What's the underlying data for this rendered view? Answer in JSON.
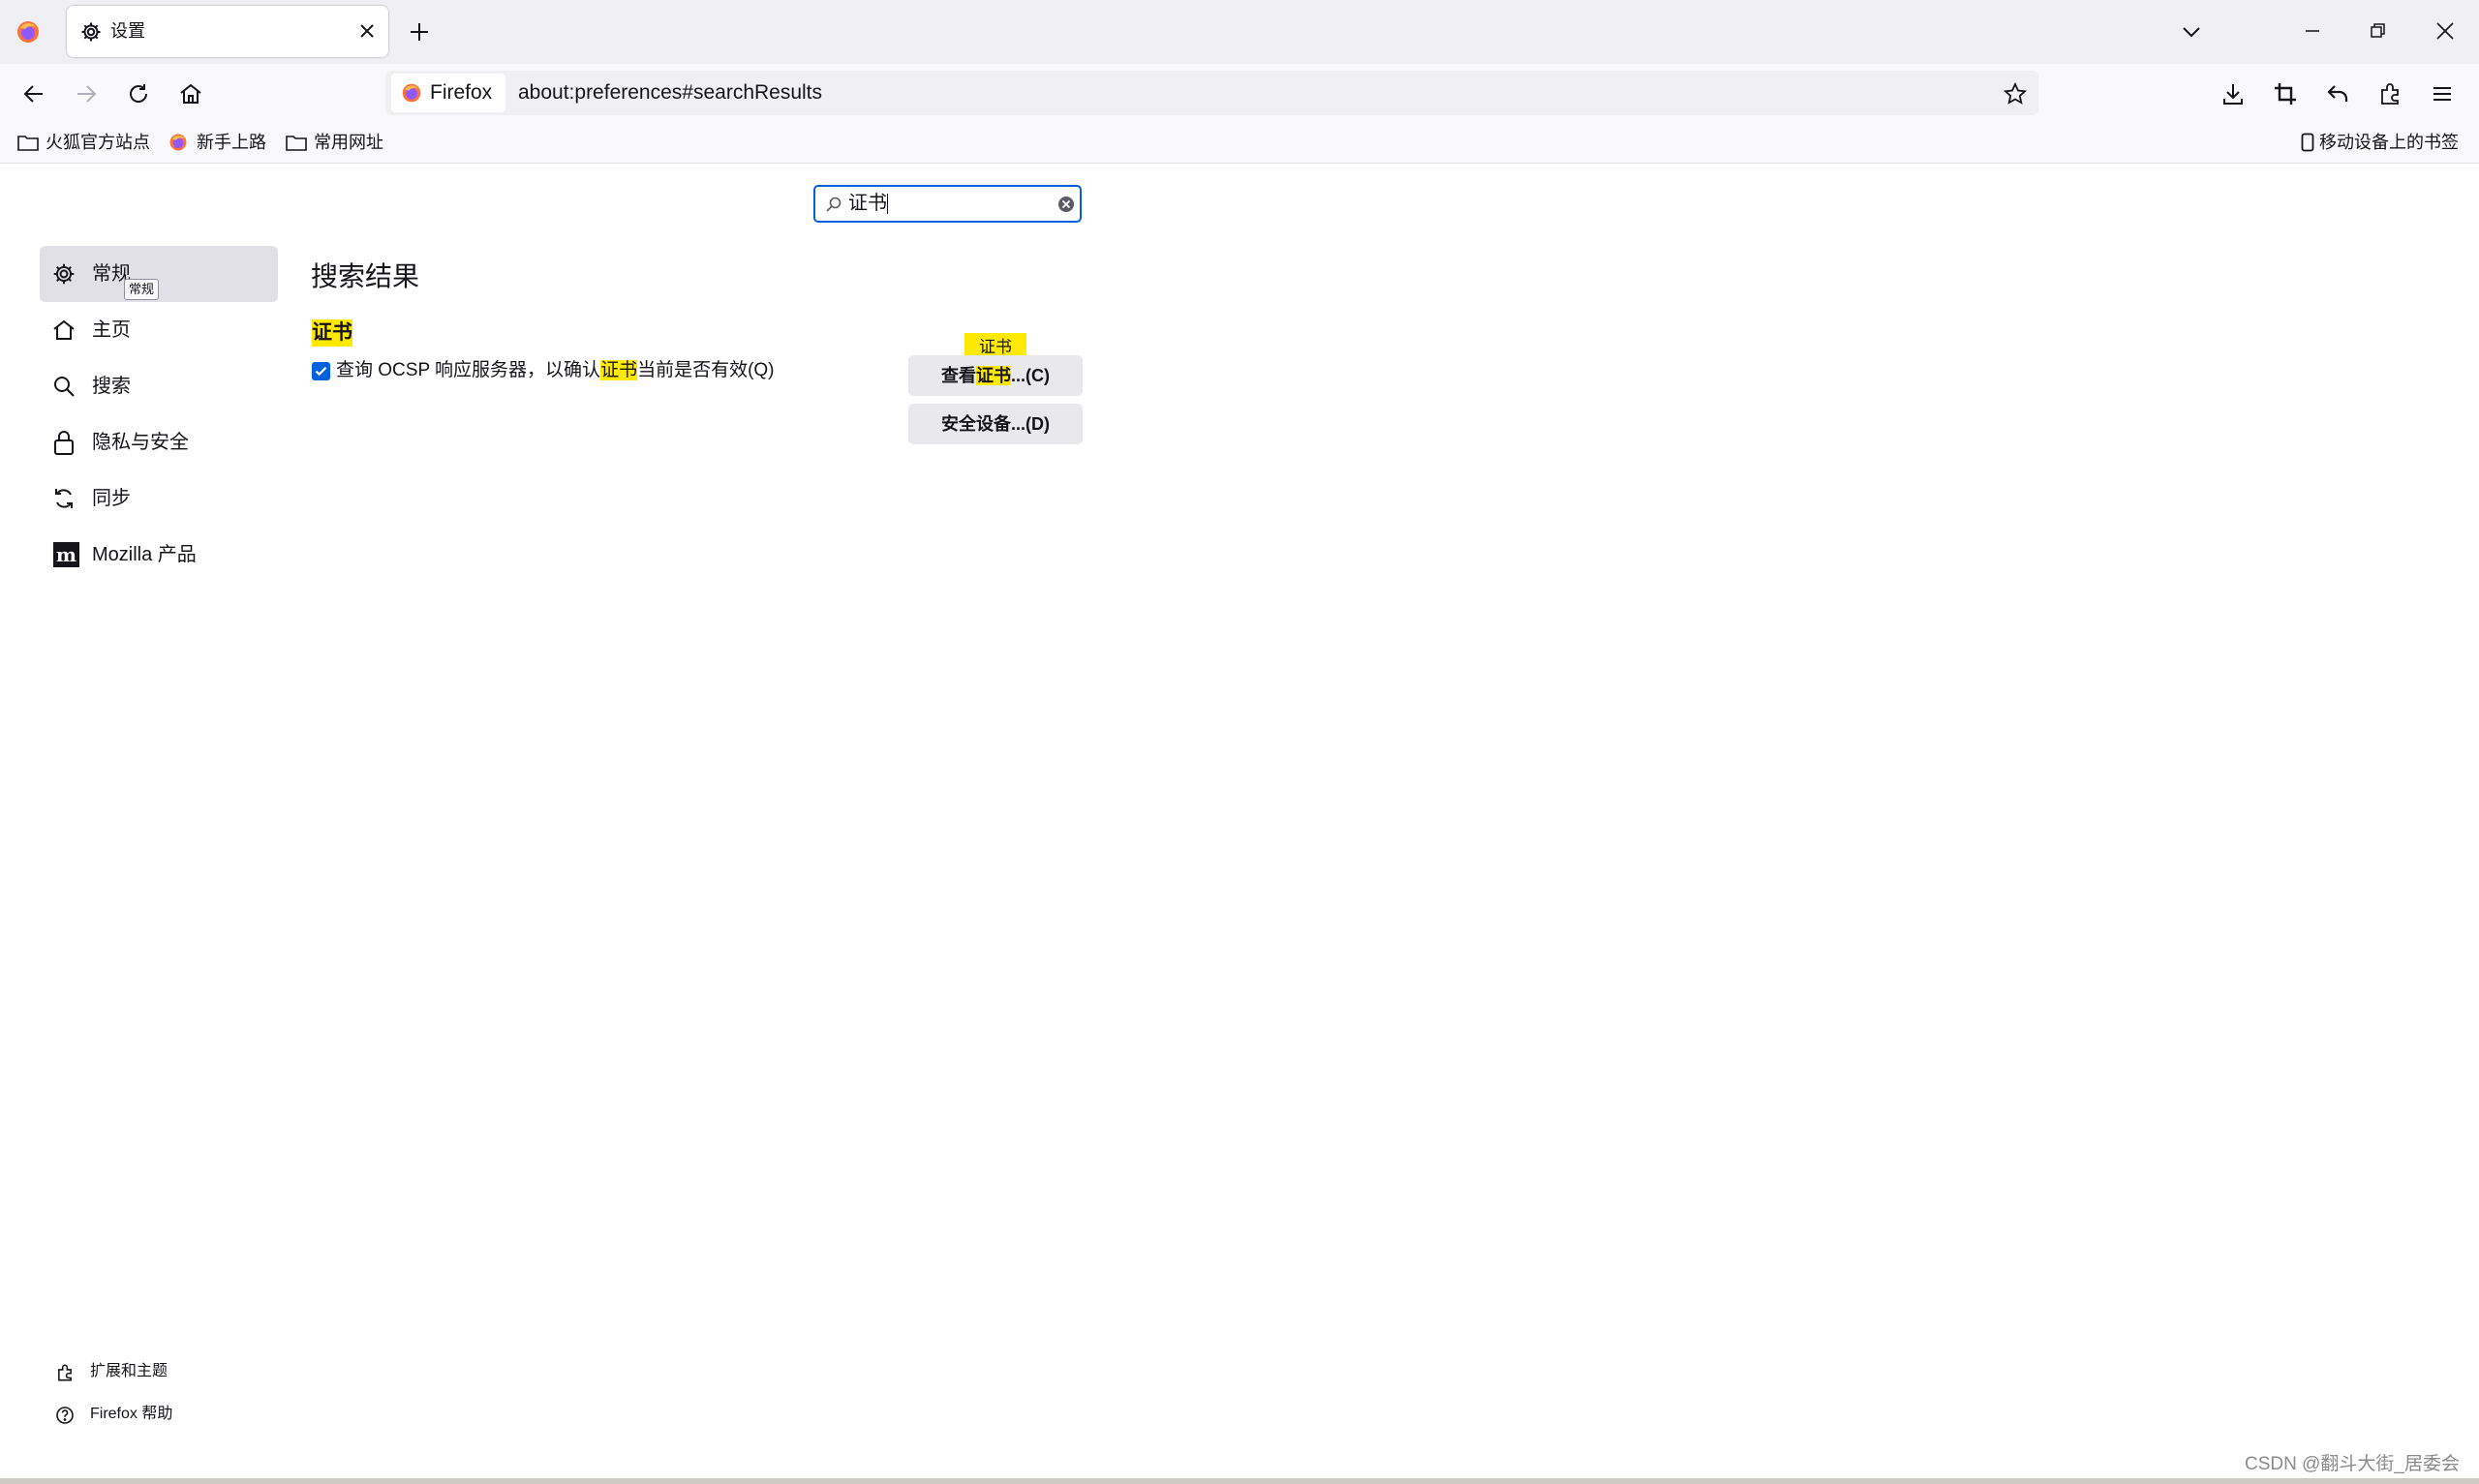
{
  "tab": {
    "title": "设置"
  },
  "urlbar": {
    "identity_label": "Firefox",
    "url": "about:preferences#searchResults"
  },
  "bookmarks": [
    {
      "label": "火狐官方站点"
    },
    {
      "label": "新手上路"
    },
    {
      "label": "常用网址"
    }
  ],
  "mobile_bookmarks": "移动设备上的书签",
  "search": {
    "value": "证书"
  },
  "categories": [
    {
      "label": "常规",
      "tooltip": "常规"
    },
    {
      "label": "主页"
    },
    {
      "label": "搜索"
    },
    {
      "label": "隐私与安全"
    },
    {
      "label": "同步"
    },
    {
      "label": "Mozilla 产品"
    }
  ],
  "footer": {
    "extensions": "扩展和主题",
    "help": "Firefox 帮助"
  },
  "results": {
    "heading": "搜索结果",
    "group_title": "证书",
    "ocsp": {
      "checked": true,
      "prefix": "查询 OCSP 响应服务器，以确认",
      "highlight": "证书",
      "suffix": "当前是否有效(Q)"
    },
    "view_button": {
      "prefix": "查看",
      "highlight": "证书",
      "suffix": "...(C)"
    },
    "badge": "证书",
    "devices_button": "安全设备...(D)"
  },
  "watermark": "CSDN @翻斗大街_居委会"
}
